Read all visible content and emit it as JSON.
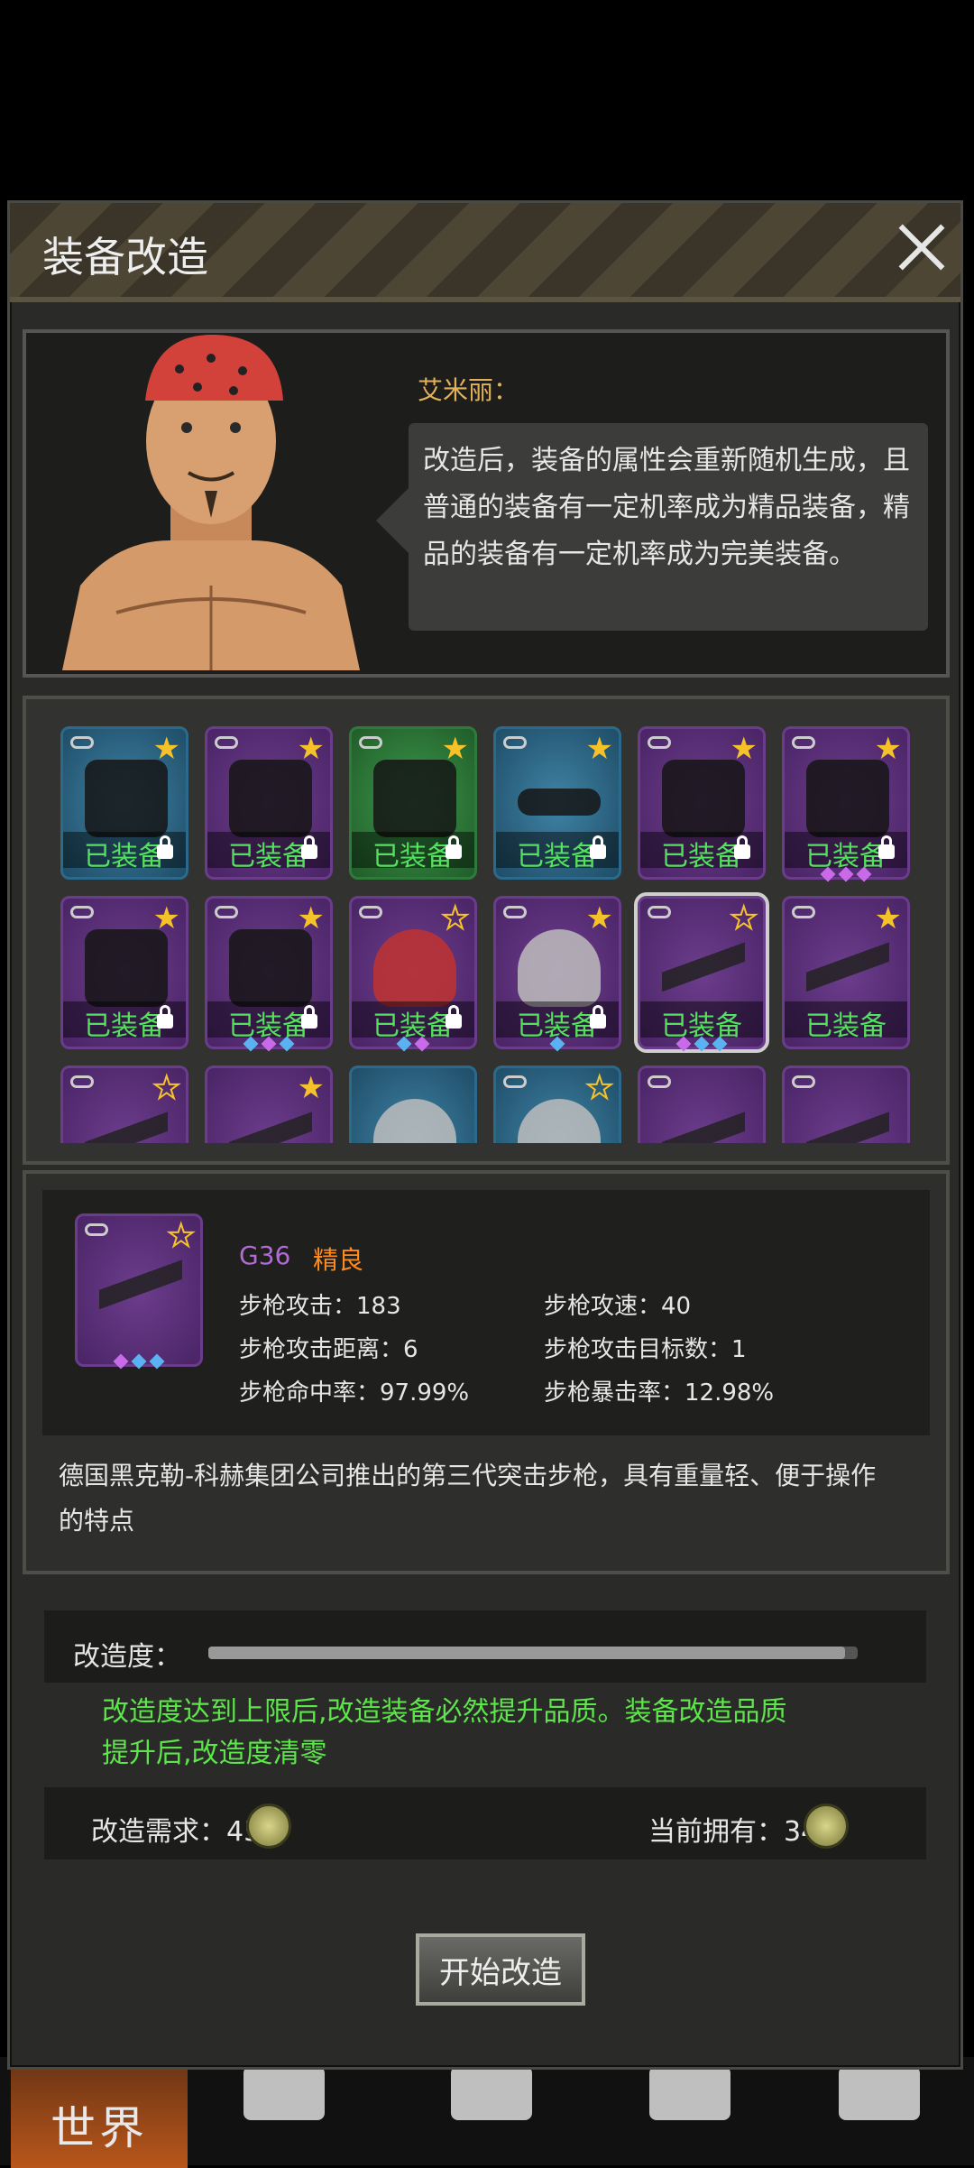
{
  "dialog": {
    "title": "装备改造"
  },
  "npc": {
    "name": "艾米丽：",
    "speech": "改造后，装备的属性会重新随机生成，且普通的装备有一定机率成为精品装备，精品的装备有一定机率成为完美装备。"
  },
  "equipment": {
    "equipped_label": "已装备",
    "row1": [
      {
        "art": "vest",
        "color": "blue",
        "star": "filled",
        "locked": true,
        "gems": []
      },
      {
        "art": "armor",
        "color": "purple",
        "star": "filled",
        "locked": true,
        "gems": []
      },
      {
        "art": "mask",
        "color": "green",
        "star": "filled",
        "locked": true,
        "gems": []
      },
      {
        "art": "glasses",
        "color": "blue",
        "star": "filled",
        "locked": true,
        "gems": []
      },
      {
        "art": "boots",
        "color": "purple",
        "star": "filled",
        "locked": true,
        "gems": []
      },
      {
        "art": "pants",
        "color": "purple",
        "star": "filled",
        "locked": true,
        "gems": [
          "purple",
          "purple",
          "purple"
        ]
      }
    ],
    "row2": [
      {
        "art": "jacket",
        "color": "purple",
        "star": "filled",
        "locked": true,
        "gems": []
      },
      {
        "art": "coat",
        "color": "purple",
        "star": "filled",
        "locked": true,
        "gems": [
          "blue",
          "purple",
          "blue"
        ]
      },
      {
        "art": "red-helmet",
        "color": "purple",
        "star": "hollow",
        "locked": true,
        "gems": [
          "blue",
          "purple"
        ]
      },
      {
        "art": "police-helmet",
        "color": "purple",
        "star": "filled",
        "locked": true,
        "gems": [
          "blue"
        ]
      },
      {
        "art": "rifle",
        "color": "purple",
        "star": "hollow",
        "locked": false,
        "selected": true,
        "gems": [
          "purple",
          "blue",
          "blue"
        ]
      },
      {
        "art": "rifle2",
        "color": "purple",
        "star": "filled",
        "locked": false,
        "gems": []
      }
    ]
  },
  "selected_item": {
    "name": "G36",
    "quality": "精良",
    "stats": [
      "步枪攻击：183",
      "步枪攻速：40",
      "步枪攻击距离：6",
      "步枪攻击目标数：1",
      "步枪命中率：97.99%",
      "步枪暴击率：12.98%"
    ],
    "description": "德国黑克勒-科赫集团公司推出的第三代突击步枪，具有重量轻、便于操作的特点"
  },
  "refine": {
    "label": "改造度：",
    "progress": 0.98,
    "note": "改造度达到上限后,改造装备必然提升品质。装备改造品质提升后,改造度清零",
    "requirement": "改造需求：45",
    "owned": "当前拥有：34",
    "start_button": "开始改造"
  },
  "nav": {
    "world": "世界"
  },
  "colors": {
    "accent_green": "#5ee54c",
    "quality_orange": "#ff8a1e",
    "name_gold": "#e2b25b"
  }
}
